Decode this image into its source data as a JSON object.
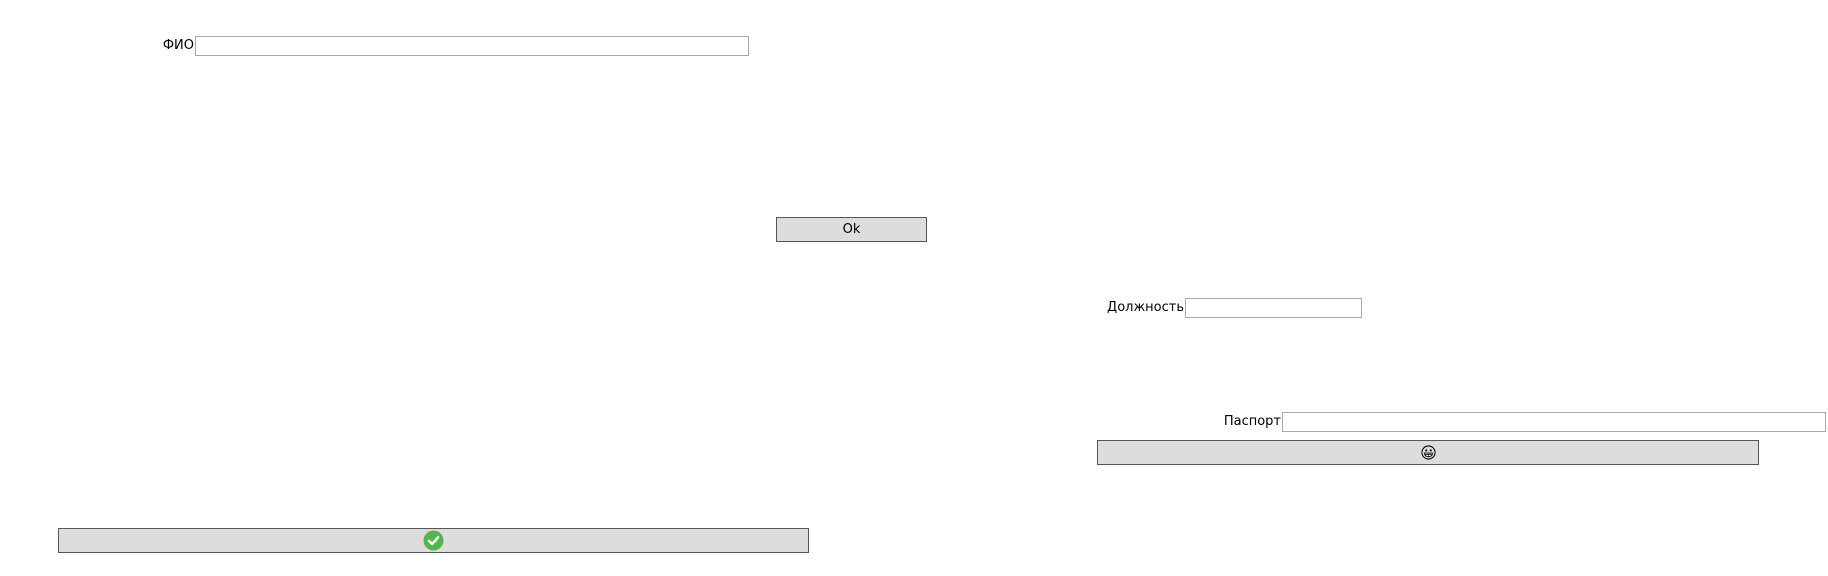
{
  "form": {
    "fio": {
      "label": "ФИО",
      "value": ""
    },
    "position": {
      "label": "Должность",
      "value": ""
    },
    "passport": {
      "label": "Паспорт",
      "value": ""
    }
  },
  "buttons": {
    "ok_label": "Ok",
    "confirm_icon": "check-circle-icon",
    "confirm_icon_color": "#4fb848",
    "emoji_icon": "grinning-face-icon"
  },
  "colors": {
    "button_fill": "#dddddd",
    "button_border": "#555555",
    "field_border": "#a9a9a9"
  }
}
